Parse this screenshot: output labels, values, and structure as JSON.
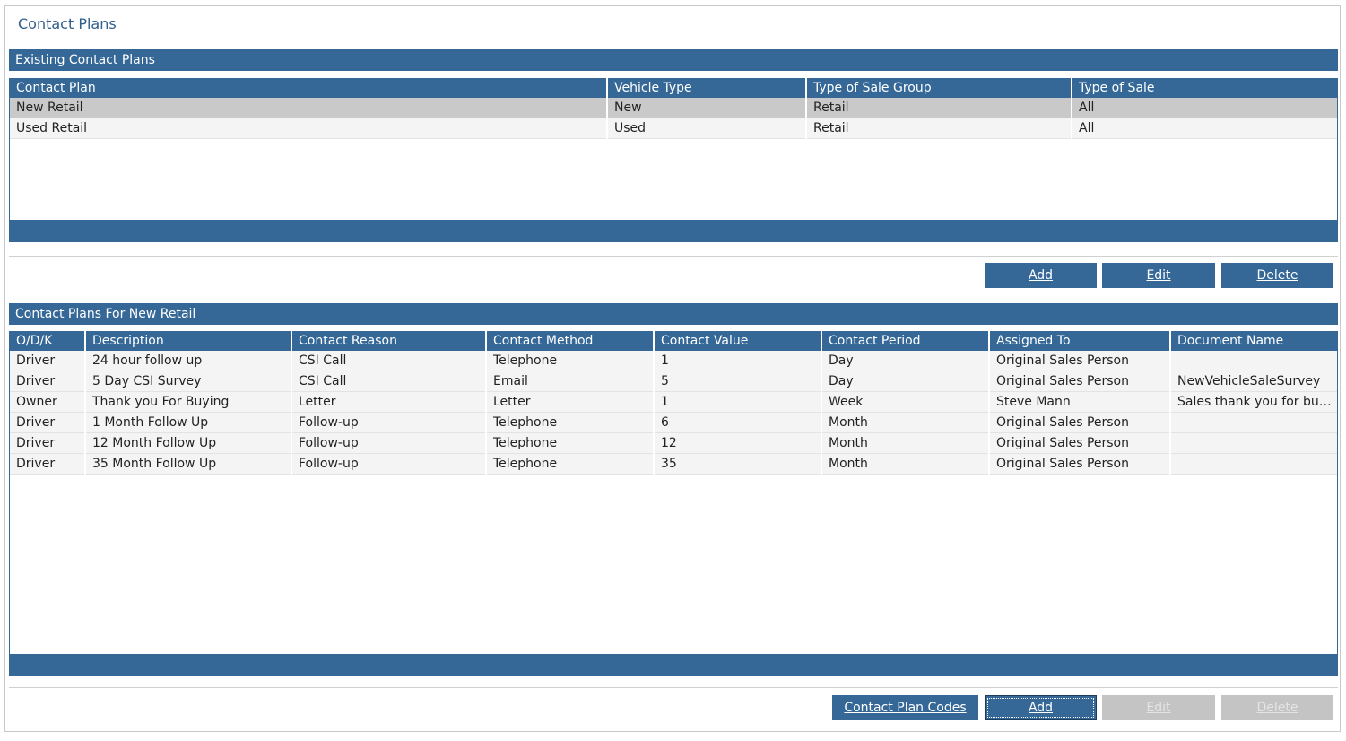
{
  "page": {
    "title": "Contact Plans"
  },
  "existing": {
    "header": "Existing Contact Plans",
    "columns": [
      "Contact Plan",
      "Vehicle Type",
      "Type of Sale Group",
      "Type of Sale"
    ],
    "rows": [
      [
        "New Retail",
        "New",
        "Retail",
        "All"
      ],
      [
        "Used Retail",
        "Used",
        "Retail",
        "All"
      ]
    ],
    "selected_index": 0,
    "buttons": {
      "add": "Add",
      "edit": "Edit",
      "delete": "Delete"
    }
  },
  "details": {
    "header": "Contact Plans For New Retail",
    "columns": [
      "O/D/K",
      "Description",
      "Contact Reason",
      "Contact Method",
      "Contact Value",
      "Contact Period",
      "Assigned To",
      "Document Name"
    ],
    "rows": [
      [
        "Driver",
        "24 hour follow up",
        "CSI Call",
        "Telephone",
        "1",
        "Day",
        "Original Sales Person",
        ""
      ],
      [
        "Driver",
        "5 Day CSI Survey",
        "CSI Call",
        "Email",
        "5",
        "Day",
        "Original Sales Person",
        "NewVehicleSaleSurvey"
      ],
      [
        "Owner",
        "Thank you For Buying",
        "Letter",
        "Letter",
        "1",
        "Week",
        "Steve Mann",
        "Sales thank you for buying letter"
      ],
      [
        "Driver",
        "1 Month Follow Up",
        "Follow-up",
        "Telephone",
        "6",
        "Month",
        "Original Sales Person",
        ""
      ],
      [
        "Driver",
        "12 Month Follow Up",
        "Follow-up",
        "Telephone",
        "12",
        "Month",
        "Original Sales Person",
        ""
      ],
      [
        "Driver",
        "35 Month Follow Up",
        "Follow-up",
        "Telephone",
        "35",
        "Month",
        "Original Sales Person",
        ""
      ]
    ],
    "buttons": {
      "codes": "Contact Plan Codes",
      "add": "Add",
      "edit": "Edit",
      "delete": "Delete"
    }
  },
  "colors": {
    "accent": "#356897",
    "title": "#2f5d8c",
    "selected_row": "#c9c9c9",
    "disabled": "#c4c4c4"
  }
}
